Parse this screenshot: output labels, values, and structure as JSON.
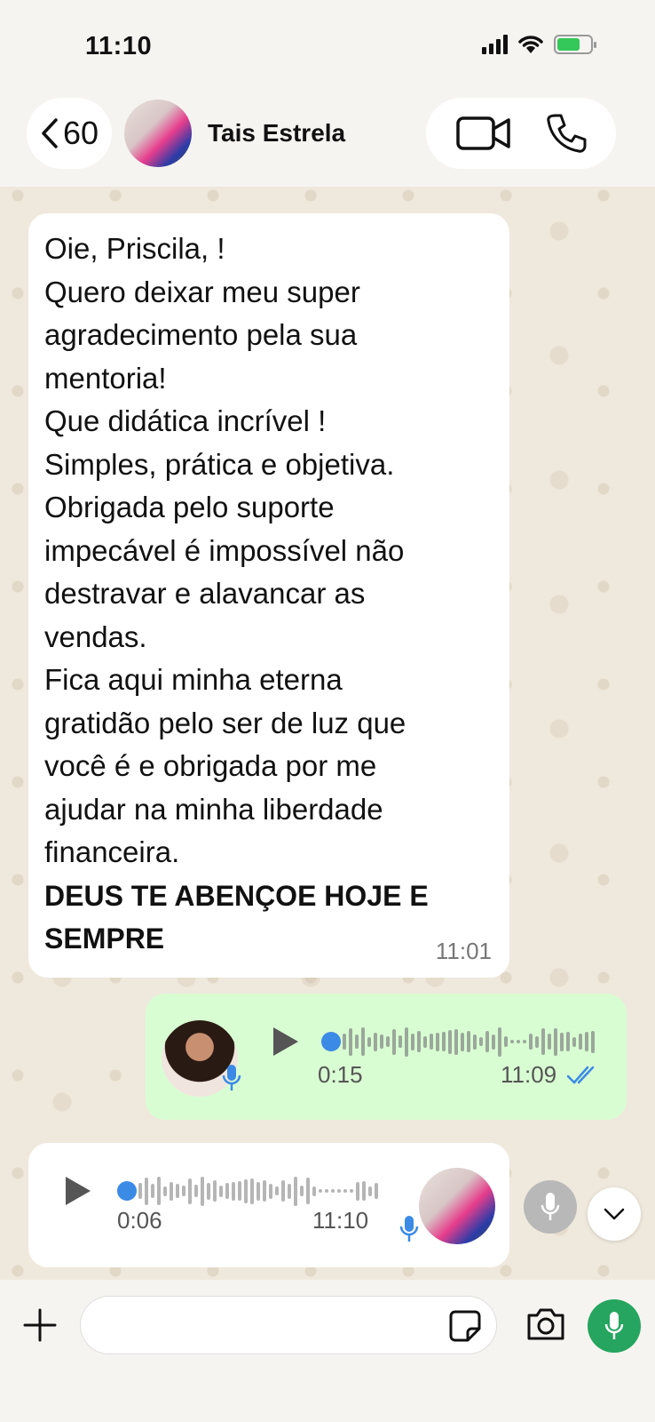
{
  "status": {
    "time": "11:10"
  },
  "header": {
    "back_count": "60",
    "contact_name": "Tais Estrela"
  },
  "messages": {
    "incoming_text": {
      "lines": [
        "Oie, Priscila, !",
        "Quero deixar meu super",
        "agradecimento pela sua",
        "mentoria!",
        "Que didática incrível !",
        "Simples, prática e objetiva.",
        "Obrigada pelo suporte",
        "impecável é impossível não",
        "destravar e alavancar as",
        "vendas.",
        "Fica aqui minha eterna",
        "gratidão pelo ser de luz que",
        "você é e obrigada por me",
        "ajudar na minha liberdade",
        "financeira."
      ],
      "bold_lines": [
        "DEUS TE ABENÇOE  HOJE E",
        "SEMPRE"
      ],
      "time": "11:01"
    },
    "outgoing_voice": {
      "duration": "0:15",
      "time": "11:09",
      "progress": 0
    },
    "incoming_voice": {
      "duration": "0:06",
      "time": "11:10",
      "progress": 0
    }
  },
  "colors": {
    "outgoing_bubble": "#d9fdd3",
    "incoming_bubble": "#ffffff",
    "accent_blue": "#3b8ae6",
    "send_green": "#25a55f"
  },
  "icons": {
    "back": "chevron-left-icon",
    "video": "video-camera-icon",
    "phone": "phone-icon",
    "play": "play-icon",
    "mic": "microphone-icon",
    "ticks": "double-check-icon",
    "scroll": "chevron-down-icon",
    "plus": "plus-icon",
    "sticker": "sticker-icon",
    "camera": "camera-icon"
  }
}
